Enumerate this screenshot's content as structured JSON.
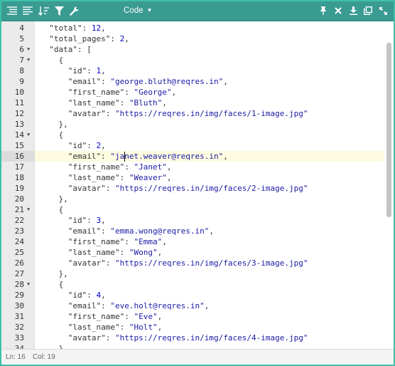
{
  "toolbar": {
    "left_icons": [
      "format-icon",
      "compact-icon",
      "sort-icon",
      "filter-icon",
      "repair-icon"
    ],
    "mode_label": "Code",
    "right_icons": [
      "pin-icon",
      "close-icon",
      "download-icon",
      "copy-icon",
      "expand-icon"
    ]
  },
  "editor": {
    "active_line": 16,
    "lines": [
      {
        "n": "4",
        "fold": "",
        "parts": [
          [
            "key",
            "  \"total\""
          ],
          [
            "pun",
            ": "
          ],
          [
            "num",
            "12"
          ],
          [
            "pun",
            ","
          ]
        ]
      },
      {
        "n": "5",
        "fold": "",
        "parts": [
          [
            "key",
            "  \"total_pages\""
          ],
          [
            "pun",
            ": "
          ],
          [
            "num",
            "2"
          ],
          [
            "pun",
            ","
          ]
        ]
      },
      {
        "n": "6",
        "fold": "down",
        "parts": [
          [
            "key",
            "  \"data\""
          ],
          [
            "pun",
            ": ["
          ]
        ]
      },
      {
        "n": "7",
        "fold": "down",
        "parts": [
          [
            "pun",
            "    {"
          ]
        ]
      },
      {
        "n": "8",
        "fold": "",
        "parts": [
          [
            "key",
            "      \"id\""
          ],
          [
            "pun",
            ": "
          ],
          [
            "num",
            "1"
          ],
          [
            "pun",
            ","
          ]
        ]
      },
      {
        "n": "9",
        "fold": "",
        "parts": [
          [
            "key",
            "      \"email\""
          ],
          [
            "pun",
            ": "
          ],
          [
            "str",
            "\"george.bluth@reqres.in\""
          ],
          [
            "pun",
            ","
          ]
        ]
      },
      {
        "n": "10",
        "fold": "",
        "parts": [
          [
            "key",
            "      \"first_name\""
          ],
          [
            "pun",
            ": "
          ],
          [
            "str",
            "\"George\""
          ],
          [
            "pun",
            ","
          ]
        ]
      },
      {
        "n": "11",
        "fold": "",
        "parts": [
          [
            "key",
            "      \"last_name\""
          ],
          [
            "pun",
            ": "
          ],
          [
            "str",
            "\"Bluth\""
          ],
          [
            "pun",
            ","
          ]
        ]
      },
      {
        "n": "12",
        "fold": "",
        "parts": [
          [
            "key",
            "      \"avatar\""
          ],
          [
            "pun",
            ": "
          ],
          [
            "str",
            "\"https://reqres.in/img/faces/1-image.jpg\""
          ]
        ]
      },
      {
        "n": "13",
        "fold": "",
        "parts": [
          [
            "pun",
            "    },"
          ]
        ]
      },
      {
        "n": "14",
        "fold": "down",
        "parts": [
          [
            "pun",
            "    {"
          ]
        ]
      },
      {
        "n": "15",
        "fold": "",
        "parts": [
          [
            "key",
            "      \"id\""
          ],
          [
            "pun",
            ": "
          ],
          [
            "num",
            "2"
          ],
          [
            "pun",
            ","
          ]
        ]
      },
      {
        "n": "16",
        "fold": "",
        "parts": [
          [
            "key",
            "      \"email\""
          ],
          [
            "pun",
            ": "
          ],
          [
            "str",
            "\"janet.weaver@reqres.in\""
          ],
          [
            "pun",
            ","
          ]
        ]
      },
      {
        "n": "17",
        "fold": "",
        "parts": [
          [
            "key",
            "      \"first_name\""
          ],
          [
            "pun",
            ": "
          ],
          [
            "str",
            "\"Janet\""
          ],
          [
            "pun",
            ","
          ]
        ]
      },
      {
        "n": "18",
        "fold": "",
        "parts": [
          [
            "key",
            "      \"last_name\""
          ],
          [
            "pun",
            ": "
          ],
          [
            "str",
            "\"Weaver\""
          ],
          [
            "pun",
            ","
          ]
        ]
      },
      {
        "n": "19",
        "fold": "",
        "parts": [
          [
            "key",
            "      \"avatar\""
          ],
          [
            "pun",
            ": "
          ],
          [
            "str",
            "\"https://reqres.in/img/faces/2-image.jpg\""
          ]
        ]
      },
      {
        "n": "20",
        "fold": "",
        "parts": [
          [
            "pun",
            "    },"
          ]
        ]
      },
      {
        "n": "21",
        "fold": "down",
        "parts": [
          [
            "pun",
            "    {"
          ]
        ]
      },
      {
        "n": "22",
        "fold": "",
        "parts": [
          [
            "key",
            "      \"id\""
          ],
          [
            "pun",
            ": "
          ],
          [
            "num",
            "3"
          ],
          [
            "pun",
            ","
          ]
        ]
      },
      {
        "n": "23",
        "fold": "",
        "parts": [
          [
            "key",
            "      \"email\""
          ],
          [
            "pun",
            ": "
          ],
          [
            "str",
            "\"emma.wong@reqres.in\""
          ],
          [
            "pun",
            ","
          ]
        ]
      },
      {
        "n": "24",
        "fold": "",
        "parts": [
          [
            "key",
            "      \"first_name\""
          ],
          [
            "pun",
            ": "
          ],
          [
            "str",
            "\"Emma\""
          ],
          [
            "pun",
            ","
          ]
        ]
      },
      {
        "n": "25",
        "fold": "",
        "parts": [
          [
            "key",
            "      \"last_name\""
          ],
          [
            "pun",
            ": "
          ],
          [
            "str",
            "\"Wong\""
          ],
          [
            "pun",
            ","
          ]
        ]
      },
      {
        "n": "26",
        "fold": "",
        "parts": [
          [
            "key",
            "      \"avatar\""
          ],
          [
            "pun",
            ": "
          ],
          [
            "str",
            "\"https://reqres.in/img/faces/3-image.jpg\""
          ]
        ]
      },
      {
        "n": "27",
        "fold": "",
        "parts": [
          [
            "pun",
            "    },"
          ]
        ]
      },
      {
        "n": "28",
        "fold": "down",
        "parts": [
          [
            "pun",
            "    {"
          ]
        ]
      },
      {
        "n": "29",
        "fold": "",
        "parts": [
          [
            "key",
            "      \"id\""
          ],
          [
            "pun",
            ": "
          ],
          [
            "num",
            "4"
          ],
          [
            "pun",
            ","
          ]
        ]
      },
      {
        "n": "30",
        "fold": "",
        "parts": [
          [
            "key",
            "      \"email\""
          ],
          [
            "pun",
            ": "
          ],
          [
            "str",
            "\"eve.holt@reqres.in\""
          ],
          [
            "pun",
            ","
          ]
        ]
      },
      {
        "n": "31",
        "fold": "",
        "parts": [
          [
            "key",
            "      \"first_name\""
          ],
          [
            "pun",
            ": "
          ],
          [
            "str",
            "\"Eve\""
          ],
          [
            "pun",
            ","
          ]
        ]
      },
      {
        "n": "32",
        "fold": "",
        "parts": [
          [
            "key",
            "      \"last_name\""
          ],
          [
            "pun",
            ": "
          ],
          [
            "str",
            "\"Holt\""
          ],
          [
            "pun",
            ","
          ]
        ]
      },
      {
        "n": "33",
        "fold": "",
        "parts": [
          [
            "key",
            "      \"avatar\""
          ],
          [
            "pun",
            ": "
          ],
          [
            "str",
            "\"https://reqres.in/img/faces/4-image.jpg\""
          ]
        ]
      },
      {
        "n": "34",
        "fold": "",
        "parts": [
          [
            "pun",
            "    },"
          ]
        ]
      }
    ]
  },
  "status": {
    "ln": "Ln: 16",
    "col": "Col: 19"
  }
}
